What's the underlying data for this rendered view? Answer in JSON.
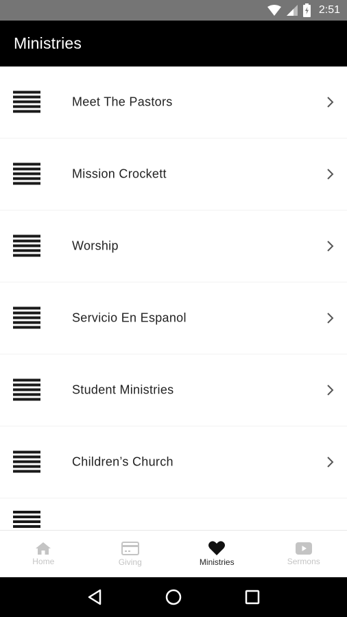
{
  "status_bar": {
    "time": "2:51",
    "icons": [
      "wifi-icon",
      "signal-icon",
      "battery-charging-icon"
    ]
  },
  "app_bar": {
    "title": "Ministries"
  },
  "list": {
    "items": [
      {
        "label": "Meet The Pastors",
        "icon": "lines-thumbnail-icon"
      },
      {
        "label": "Mission Crockett",
        "icon": "lines-thumbnail-icon"
      },
      {
        "label": "Worship",
        "icon": "lines-thumbnail-icon"
      },
      {
        "label": "Servicio En Espanol",
        "icon": "lines-thumbnail-icon"
      },
      {
        "label": "Student Ministries",
        "icon": "lines-thumbnail-icon"
      },
      {
        "label": "Children’s Church",
        "icon": "lines-thumbnail-icon"
      }
    ]
  },
  "bottom_nav": {
    "tabs": [
      {
        "label": "Home",
        "icon": "home-icon",
        "active": false
      },
      {
        "label": "Giving",
        "icon": "card-icon",
        "active": false
      },
      {
        "label": "Ministries",
        "icon": "heart-icon",
        "active": true
      },
      {
        "label": "Sermons",
        "icon": "play-video-icon",
        "active": false
      }
    ]
  },
  "system_nav": {
    "buttons": [
      "back-icon",
      "home-circle-icon",
      "recents-icon"
    ]
  },
  "colors": {
    "app_bar": "#000000",
    "status_bar": "#757575",
    "active_tab": "#222222",
    "inactive_tab": "#c4c4c4"
  }
}
